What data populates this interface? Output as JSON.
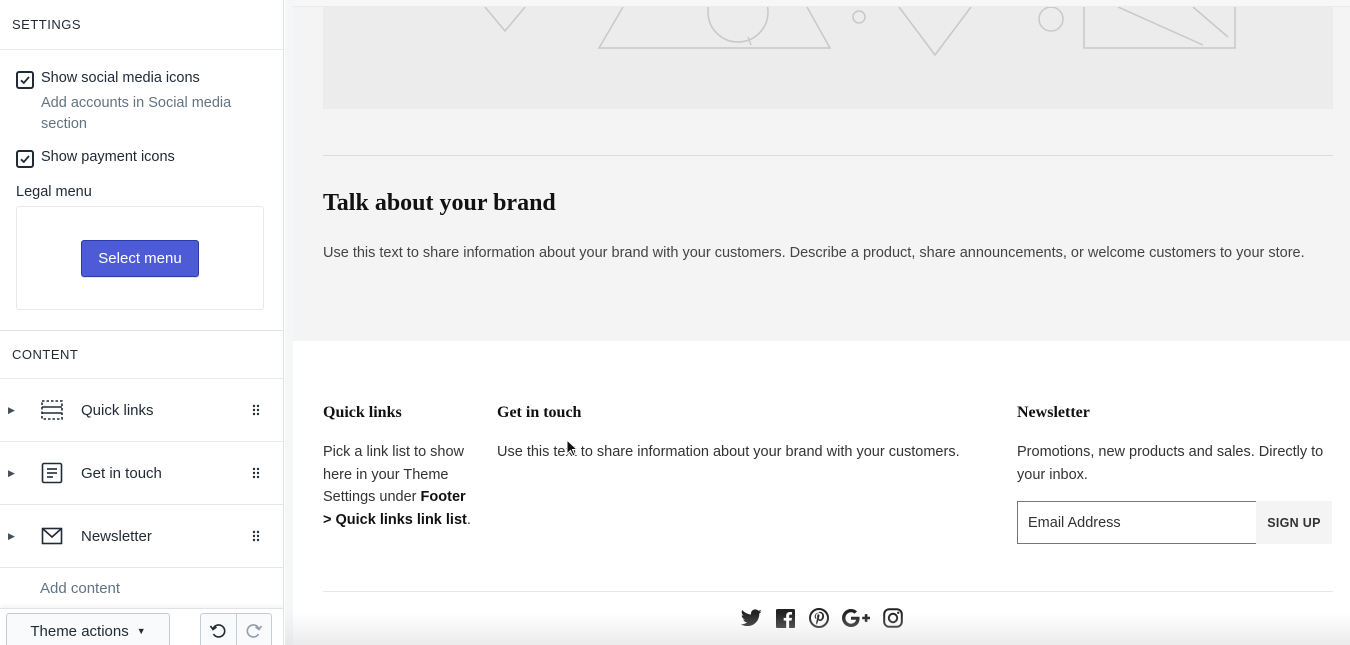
{
  "sidebar": {
    "settings_heading": "SETTINGS",
    "social_checkbox": {
      "label": "Show social media icons",
      "checked": true,
      "help": "Add accounts in Social media section"
    },
    "payment_checkbox": {
      "label": "Show payment icons",
      "checked": true
    },
    "legal_menu": {
      "label": "Legal menu",
      "button": "Select menu"
    },
    "content_heading": "CONTENT",
    "blocks": [
      {
        "label": "Quick links",
        "icon": "quick-links-icon"
      },
      {
        "label": "Get in touch",
        "icon": "text-icon"
      },
      {
        "label": "Newsletter",
        "icon": "envelope-icon"
      }
    ],
    "add_content": "Add content",
    "theme_actions": "Theme actions"
  },
  "preview": {
    "brand_title": "Talk about your brand",
    "brand_text": "Use this text to share information about your brand with your customers. Describe a product, share announcements, or welcome customers to your store.",
    "footer": {
      "quick_links": {
        "title": "Quick links",
        "text_pre": "Pick a link list to show here in your Theme Settings under ",
        "text_bold": "Footer > Quick links link list",
        "text_post": "."
      },
      "get_in_touch": {
        "title": "Get in touch",
        "text": "Use this text to share information about your brand with your customers."
      },
      "newsletter": {
        "title": "Newsletter",
        "text": "Promotions, new products and sales. Directly to your inbox.",
        "email_placeholder": "Email Address",
        "signup": "SIGN UP"
      },
      "socials": [
        "twitter-icon",
        "facebook-icon",
        "pinterest-icon",
        "google-plus-icon",
        "instagram-icon"
      ]
    }
  },
  "colors": {
    "primary_button": "#4d5bd6",
    "text": "#212b36",
    "gray_section": "#f4f4f4"
  }
}
